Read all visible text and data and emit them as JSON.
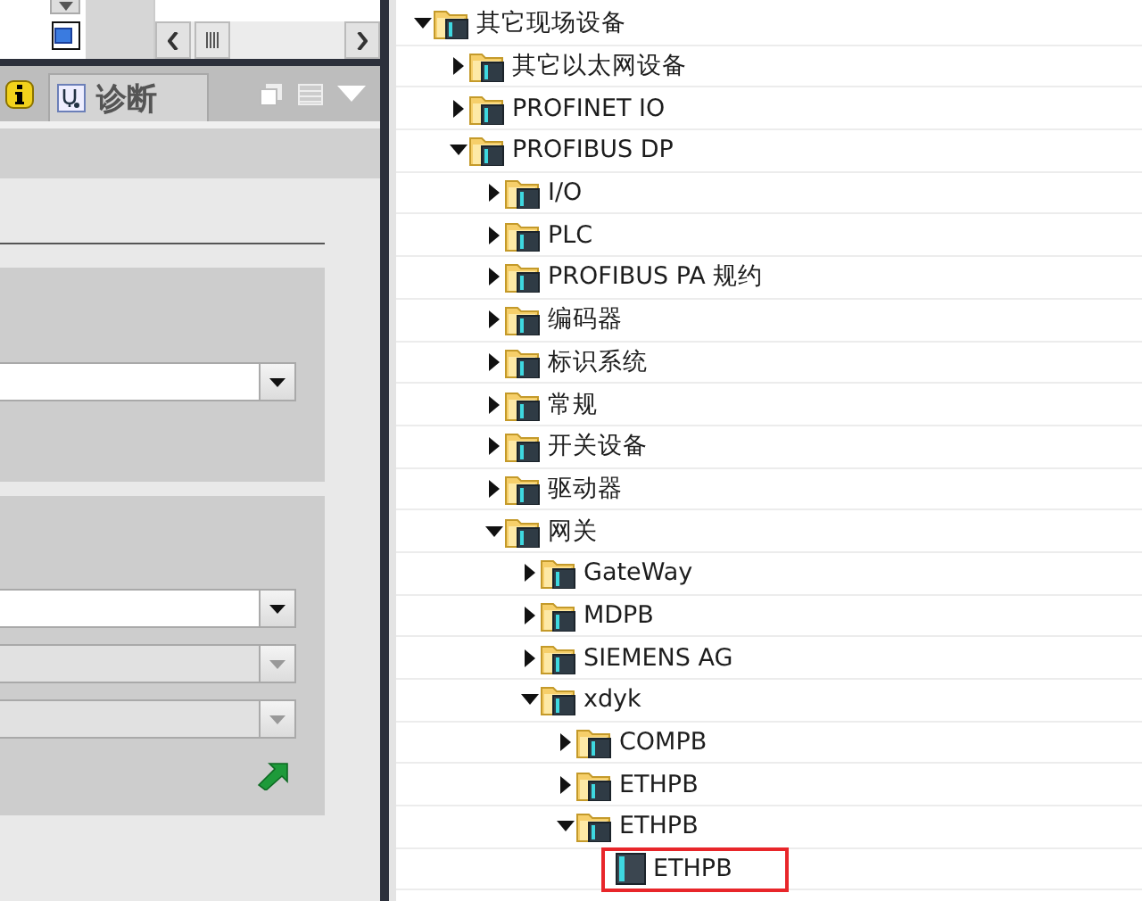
{
  "left_panel": {
    "tabs": [
      {
        "label": "诊断",
        "selected": true
      }
    ],
    "groups": [
      {
        "dropdowns": [
          {
            "disabled": false
          }
        ]
      },
      {
        "dropdowns": [
          {
            "disabled": false
          },
          {
            "disabled": true
          },
          {
            "disabled": true
          }
        ]
      }
    ]
  },
  "tree": [
    {
      "label": "其它现场设备",
      "kind": "folder",
      "expanded": true,
      "children": [
        {
          "label": "其它以太网设备",
          "kind": "folder",
          "expanded": false
        },
        {
          "label": "PROFINET IO",
          "kind": "folder",
          "expanded": false
        },
        {
          "label": "PROFIBUS DP",
          "kind": "folder",
          "expanded": true,
          "children": [
            {
              "label": "I/O",
              "kind": "folder",
              "expanded": false
            },
            {
              "label": "PLC",
              "kind": "folder",
              "expanded": false
            },
            {
              "label": "PROFIBUS PA 规约",
              "kind": "folder",
              "expanded": false
            },
            {
              "label": "编码器",
              "kind": "folder",
              "expanded": false
            },
            {
              "label": "标识系统",
              "kind": "folder",
              "expanded": false
            },
            {
              "label": "常规",
              "kind": "folder",
              "expanded": false
            },
            {
              "label": "开关设备",
              "kind": "folder",
              "expanded": false
            },
            {
              "label": "驱动器",
              "kind": "folder",
              "expanded": false
            },
            {
              "label": "网关",
              "kind": "folder",
              "expanded": true,
              "children": [
                {
                  "label": "GateWay",
                  "kind": "folder",
                  "expanded": false
                },
                {
                  "label": "MDPB",
                  "kind": "folder",
                  "expanded": false
                },
                {
                  "label": "SIEMENS AG",
                  "kind": "folder",
                  "expanded": false
                },
                {
                  "label": "xdyk",
                  "kind": "folder",
                  "expanded": true,
                  "children": [
                    {
                      "label": "COMPB",
                      "kind": "folder",
                      "expanded": false
                    },
                    {
                      "label": "ETHPB",
                      "kind": "folder",
                      "expanded": false
                    },
                    {
                      "label": "ETHPB",
                      "kind": "folder",
                      "expanded": true,
                      "children": [
                        {
                          "label": "ETHPB",
                          "kind": "device",
                          "highlighted": true
                        }
                      ]
                    }
                  ]
                }
              ]
            }
          ]
        }
      ]
    }
  ]
}
